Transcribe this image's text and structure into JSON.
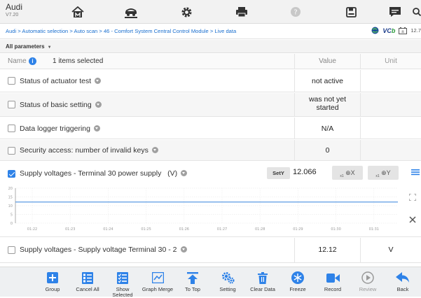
{
  "app": {
    "title": "Audi",
    "version": "V7.20"
  },
  "breadcrumb": "Audi > Automatic selection > Auto scan > 46 - Comfort System Central Control Module > Live data",
  "status": {
    "vci_label": "VC",
    "vci_suffix": "b",
    "battery": "12.7"
  },
  "filter": {
    "label": "All parameters"
  },
  "header": {
    "name": "Name",
    "info_icon": "i",
    "selected": "1 items selected",
    "value": "Value",
    "unit": "Unit"
  },
  "rows": [
    {
      "label": "Status of actuator test",
      "value": "not active",
      "unit": "",
      "checked": false
    },
    {
      "label": "Status of basic setting",
      "value": "was not yet started",
      "unit": "",
      "checked": false
    },
    {
      "label": "Data logger triggering",
      "value": "N/A",
      "unit": "",
      "checked": false
    },
    {
      "label": "Security access: number of invalid keys",
      "value": "0",
      "unit": "",
      "checked": false
    },
    {
      "label": "Supply voltages - Terminal 30 power supply   (V)",
      "value": "12.066",
      "unit": "",
      "checked": true
    },
    {
      "label": "Supply voltages - Supply voltage Terminal 30 - 2",
      "value": "12.12",
      "unit": "V",
      "checked": false
    }
  ],
  "graph_controls": {
    "sety": "SetY",
    "zoom_x": "X",
    "zoom_y": "Y",
    "zoom_prefix": "x1"
  },
  "chart_data": {
    "type": "line",
    "title": "",
    "xlabel": "",
    "ylabel": "",
    "x_ticks": [
      "01:22",
      "01:23",
      "01:24",
      "01:25",
      "01:26",
      "01:27",
      "01:28",
      "01:29",
      "01:30",
      "01:31"
    ],
    "y_ticks": [
      0,
      5,
      10,
      15,
      20
    ],
    "ylim": [
      0,
      20
    ],
    "series": [
      {
        "values": [
          12.07,
          12.07,
          12.07,
          12.07,
          12.07,
          12.07,
          12.07,
          12.07,
          12.07,
          12.07,
          12.07
        ]
      }
    ],
    "grid": true,
    "line_color": "#4a8fe0"
  },
  "toolbar": [
    {
      "label": "Group",
      "icon": "plus-square-icon"
    },
    {
      "label": "Cancel All",
      "icon": "cancel-all-icon"
    },
    {
      "label": "Show Selected",
      "icon": "show-selected-icon"
    },
    {
      "label": "Graph Merge",
      "icon": "graph-merge-icon"
    },
    {
      "label": "To Top",
      "icon": "to-top-icon"
    },
    {
      "label": "Setting",
      "icon": "gears-icon"
    },
    {
      "label": "Clear Data",
      "icon": "trash-icon"
    },
    {
      "label": "Freeze",
      "icon": "snowflake-icon"
    },
    {
      "label": "Record",
      "icon": "video-icon"
    },
    {
      "label": "Review",
      "icon": "play-circle-icon"
    },
    {
      "label": "Back",
      "icon": "back-arrow-icon"
    }
  ],
  "colors": {
    "accent": "#2e82e8",
    "line": "#4a8fe0"
  }
}
